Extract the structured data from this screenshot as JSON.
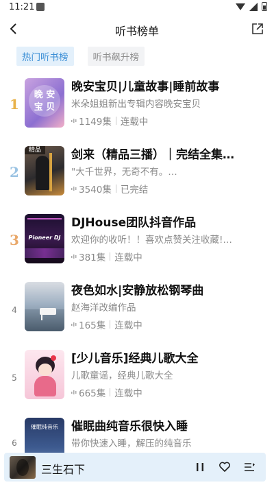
{
  "status": {
    "time": "11:21"
  },
  "nav": {
    "title": "听书榜单"
  },
  "tabs": [
    {
      "label": "热门听书榜",
      "active": true
    },
    {
      "label": "听书飙升榜",
      "active": false
    }
  ],
  "items": [
    {
      "rank": "1",
      "title": "晚安宝贝|儿童故事|睡前故事",
      "desc": "米朵姐姐新出专辑内容晚安宝贝",
      "count": "1149集",
      "status": "连载中",
      "cover_text": "晚 安\n宝 贝"
    },
    {
      "rank": "2",
      "title": "剑来（精品三播）｜完结全集…",
      "desc": "\"大千世界，无奇不有。…",
      "count": "3540集",
      "status": "已完结",
      "cover_text": "精品"
    },
    {
      "rank": "3",
      "title": "DJHouse团队抖音作品",
      "desc": "欢迎你的收听！！喜欢点赞关注收藏!…",
      "count": "381集",
      "status": "连载中",
      "cover_text": "Pioneer DJ"
    },
    {
      "rank": "4",
      "title": "夜色如水|安静放松钢琴曲",
      "desc": "赵海洋改编作品",
      "count": "165集",
      "status": "连载中",
      "cover_text": ""
    },
    {
      "rank": "5",
      "title": "[少儿音乐]经典儿歌大全",
      "desc": "儿歌童谣，经典儿歌大全",
      "count": "665集",
      "status": "连载中",
      "cover_text": ""
    },
    {
      "rank": "6",
      "title": "催眠曲纯音乐很快入睡",
      "desc": "带你快速入睡，解压的纯音乐",
      "count": "",
      "status": "",
      "cover_text": "催眠纯音乐"
    }
  ],
  "player": {
    "title": "三生石下"
  },
  "colors": {
    "accent": "#3c8fd6",
    "rank1": "#e8b24a",
    "rank2": "#9bc3e3",
    "rank3": "#e9a86a"
  }
}
